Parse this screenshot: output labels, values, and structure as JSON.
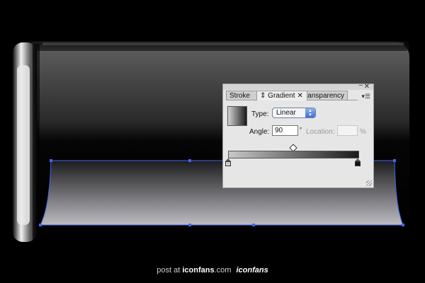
{
  "colors": {
    "background": "#000000",
    "selection": "#3366ff",
    "panel_bg": "#e6e6e6",
    "select_accent": "#3e6fd0"
  },
  "panel": {
    "tabs": [
      {
        "label": "Stroke"
      },
      {
        "label": "Gradient"
      },
      {
        "label": "Transparency"
      }
    ],
    "close_icon": "close-icon",
    "menu_icon": "panel-menu-icon",
    "type_label": "Type:",
    "type_value": "Linear",
    "angle_label": "Angle:",
    "angle_value": "90",
    "degree_symbol": "°",
    "location_label": "Location:",
    "location_value": "",
    "percent_symbol": "%"
  },
  "footer": {
    "prefix": "post at",
    "site": "iconfans",
    "suffix": ".com",
    "logo": "iconfans"
  }
}
